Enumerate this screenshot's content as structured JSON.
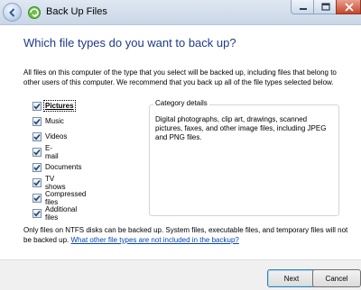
{
  "window": {
    "title": "Back Up Files",
    "back_icon": "back-arrow-icon",
    "app_icon": "backup-icon"
  },
  "main": {
    "heading": "Which file types do you want to back up?",
    "intro": "All files on this computer of the type that you select will be backed up, including files that belong to other users of this computer. We recommend that you back up all of the file types selected below."
  },
  "file_types": [
    {
      "label": "Pictures",
      "checked": true,
      "focused": true
    },
    {
      "label": "Music",
      "checked": true
    },
    {
      "label": "Videos",
      "checked": true
    },
    {
      "label": "E-mail",
      "checked": true
    },
    {
      "label": "Documents",
      "checked": true
    },
    {
      "label": "TV shows",
      "checked": true
    },
    {
      "label": "Compressed files",
      "checked": true
    },
    {
      "label": "Additional files",
      "checked": true
    }
  ],
  "category": {
    "title": "Category details",
    "description": "Digital photographs, clip art, drawings, scanned pictures, faxes, and other image files, including JPEG and PNG files."
  },
  "footer": {
    "note": "Only files on NTFS disks can be backed up. System files, executable files, and temporary files will not be backed up.",
    "link": "What other file types are not included in the backup?"
  },
  "buttons": {
    "next": "Next",
    "cancel": "Cancel"
  },
  "colors": {
    "heading": "#1e3a8c",
    "link": "#0645ad",
    "title_bar": "#c9d6e6"
  }
}
